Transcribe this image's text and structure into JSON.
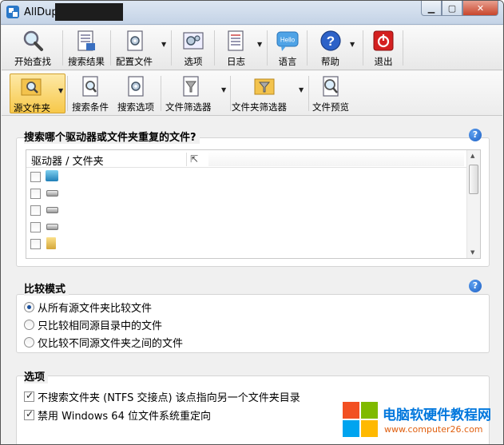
{
  "window": {
    "title": "AllDup"
  },
  "toolbar_main": [
    {
      "id": "start-search",
      "label": "开始查找",
      "icon": "magnifier-icon",
      "dropdown": false
    },
    {
      "id": "search-results",
      "label": "搜索结果",
      "icon": "results-document-icon",
      "dropdown": false
    },
    {
      "id": "profile",
      "label": "配置文件",
      "icon": "profile-gear-icon",
      "dropdown": true
    },
    {
      "id": "options",
      "label": "选项",
      "icon": "options-gear-icon",
      "dropdown": false
    },
    {
      "id": "log",
      "label": "日志",
      "icon": "log-document-icon",
      "dropdown": true
    },
    {
      "id": "language",
      "label": "语言",
      "icon": "hello-bubble-icon",
      "icon_text": "Hello",
      "dropdown": false
    },
    {
      "id": "help",
      "label": "帮助",
      "icon": "question-icon",
      "icon_text": "?",
      "dropdown": true
    },
    {
      "id": "exit",
      "label": "退出",
      "icon": "power-icon",
      "dropdown": false
    }
  ],
  "toolbar_sub": [
    {
      "id": "source-folders",
      "label": "源文件夹",
      "icon": "source-folder-icon",
      "dropdown": true,
      "active": true
    },
    {
      "id": "search-criteria",
      "label": "搜索条件",
      "icon": "search-criteria-icon",
      "dropdown": false
    },
    {
      "id": "search-options",
      "label": "搜索选项",
      "icon": "search-options-icon",
      "dropdown": false
    },
    {
      "id": "file-filter",
      "label": "文件筛选器",
      "icon": "file-filter-icon",
      "dropdown": true
    },
    {
      "id": "folder-filter",
      "label": "文件夹筛选器",
      "icon": "folder-filter-icon",
      "dropdown": true
    },
    {
      "id": "file-preview",
      "label": "文件预览",
      "icon": "file-preview-icon",
      "dropdown": false
    }
  ],
  "source_section": {
    "title": "搜索哪个驱动器或文件夹重复的文件?",
    "help": "?",
    "column_header": "驱动器 / 文件夹",
    "rows": [
      {
        "icon": "network-drive-icon",
        "checked": false
      },
      {
        "icon": "hard-drive-icon",
        "checked": false
      },
      {
        "icon": "hard-drive-icon",
        "checked": false
      },
      {
        "icon": "hard-drive-icon",
        "checked": false
      },
      {
        "icon": "folder-icon",
        "checked": false
      }
    ]
  },
  "compare_section": {
    "title": "比较模式",
    "help": "?",
    "options": [
      {
        "label": "从所有源文件夹比较文件",
        "checked": true
      },
      {
        "label": "只比较相同源目录中的文件",
        "checked": false
      },
      {
        "label": "仅比较不同源文件夹之间的文件",
        "checked": false
      }
    ]
  },
  "options_section": {
    "title": "选项",
    "items": [
      {
        "label": "不搜索文件夹 (NTFS 交接点) 该点指向另一个文件夹目录",
        "checked": true
      },
      {
        "label": "禁用 Windows 64 位文件系统重定向",
        "checked": true
      }
    ]
  },
  "watermark": {
    "name": "电脑软硬件教程网",
    "url": "www.computer26.com"
  },
  "colors": {
    "active_tool": "#f7c84a",
    "help_blue": "#1d5fc4",
    "exit_red": "#d42020",
    "watermark_blue": "#0077dd",
    "watermark_orange": "#e06010"
  }
}
